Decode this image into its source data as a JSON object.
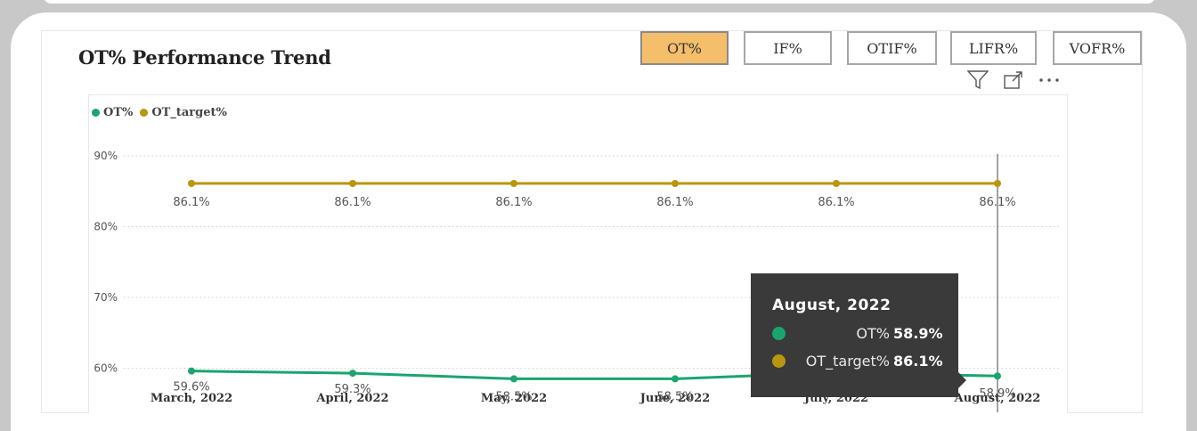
{
  "title": "OT% Performance Trend",
  "tabs": [
    {
      "label": "OT%",
      "active": true
    },
    {
      "label": "IF%",
      "active": false
    },
    {
      "label": "OTIF%",
      "active": false
    },
    {
      "label": "LIFR%",
      "active": false
    },
    {
      "label": "VOFR%",
      "active": false
    }
  ],
  "header_icons": [
    "filter-icon",
    "focus-mode-icon",
    "more-options-icon"
  ],
  "colors": {
    "ot": "#1aa56e",
    "target": "#b8960f",
    "active_tab": "#f4be6a",
    "tooltip_bg": "#3a3a3a"
  },
  "chart_data": {
    "type": "line",
    "categories": [
      "March, 2022",
      "April, 2022",
      "May, 2022",
      "June, 2022",
      "July, 2022",
      "August, 2022"
    ],
    "series": [
      {
        "name": "OT%",
        "values": [
          59.6,
          59.3,
          58.5,
          58.5,
          59.4,
          58.9
        ],
        "labels": [
          "59.6%",
          "59.3%",
          "58.5%",
          "58.5%",
          "59.4%",
          "58.9%"
        ]
      },
      {
        "name": "OT_target%",
        "values": [
          86.1,
          86.1,
          86.1,
          86.1,
          86.1,
          86.1
        ],
        "labels": [
          "86.1%",
          "86.1%",
          "86.1%",
          "86.1%",
          "86.1%",
          "86.1%"
        ]
      }
    ],
    "yticks": [
      "60%",
      "70%",
      "80%",
      "90%"
    ],
    "ylim": [
      58,
      90
    ],
    "grid": true,
    "legend": "top-left"
  },
  "tooltip": {
    "title": "August, 2022",
    "rows": [
      {
        "label": "OT%",
        "value": "58.9%"
      },
      {
        "label": "OT_target%",
        "value": "86.1%"
      }
    ]
  }
}
